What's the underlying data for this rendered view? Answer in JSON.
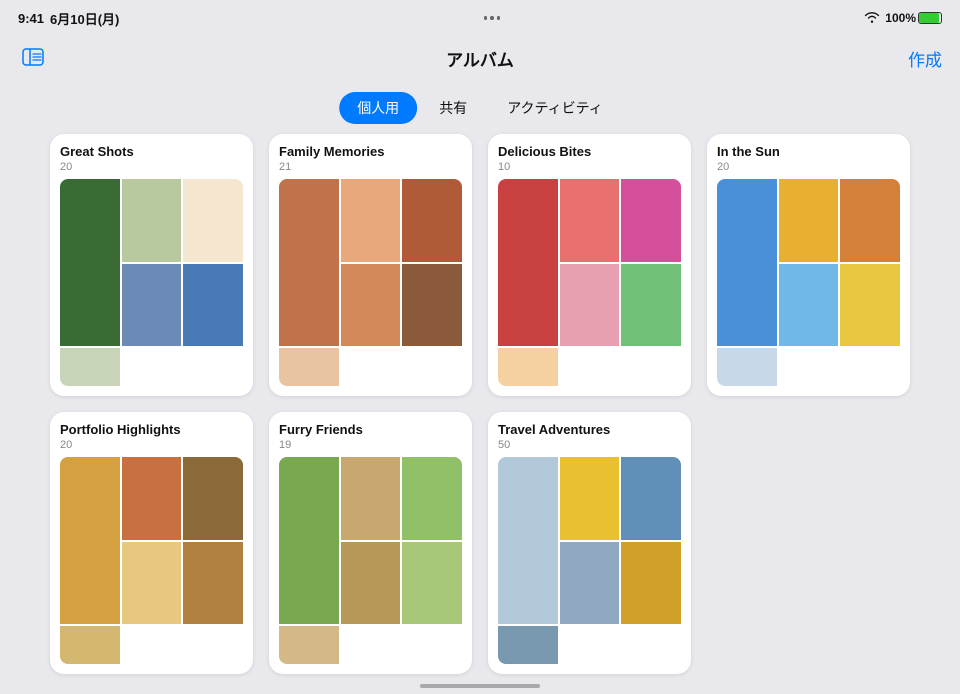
{
  "statusBar": {
    "time": "9:41",
    "date": "6月10日(月)",
    "battery": "100%"
  },
  "nav": {
    "title": "アルバム",
    "createLabel": "作成"
  },
  "segments": [
    {
      "id": "personal",
      "label": "個人用",
      "active": true
    },
    {
      "id": "shared",
      "label": "共有",
      "active": false
    },
    {
      "id": "activity",
      "label": "アクティビティ",
      "active": false
    }
  ],
  "albums": [
    {
      "id": "great-shots",
      "title": "Great Shots",
      "count": "20",
      "colorPrefix": "gs"
    },
    {
      "id": "family-memories",
      "title": "Family Memories",
      "count": "21",
      "colorPrefix": "fm"
    },
    {
      "id": "delicious-bites",
      "title": "Delicious Bites",
      "count": "10",
      "colorPrefix": "db"
    },
    {
      "id": "in-the-sun",
      "title": "In the Sun",
      "count": "20",
      "colorPrefix": "is"
    },
    {
      "id": "portfolio-highlights",
      "title": "Portfolio Highlights",
      "count": "20",
      "colorPrefix": "ph"
    },
    {
      "id": "furry-friends",
      "title": "Furry Friends",
      "count": "19",
      "colorPrefix": "ff"
    },
    {
      "id": "travel-adventures",
      "title": "Travel Adventures",
      "count": "50",
      "colorPrefix": "ta"
    }
  ]
}
